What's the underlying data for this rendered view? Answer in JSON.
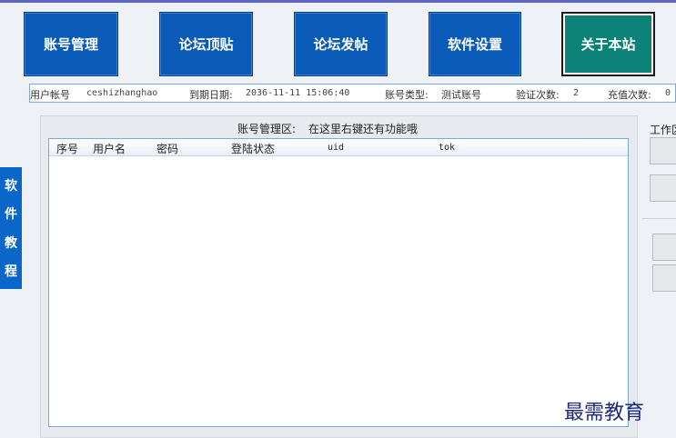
{
  "nav": {
    "account_mgmt": "账号管理",
    "forum_bump": "论坛顶贴",
    "forum_post": "论坛发帖",
    "software_settings": "软件设置",
    "about_site": "关于本站"
  },
  "info": {
    "user_label": "用户帐号",
    "user_value": "ceshizhanghao",
    "expiry_label": "到期日期:",
    "expiry_value": "2036-11-11 15:06:40",
    "type_label": "账号类型:",
    "type_value": "测试账号",
    "verify_label": "验证次数:",
    "verify_value": "2",
    "recharge_label": "充值次数:",
    "recharge_value": "0"
  },
  "side_tab": [
    "软",
    "件",
    "教",
    "程"
  ],
  "panel": {
    "title": "账号管理区:",
    "hint": "在这里右键还有功能哦"
  },
  "columns": [
    "序号",
    "用户名",
    "密码",
    "登陆状态",
    "uid",
    "tok"
  ],
  "right_panel": {
    "label": "工作区"
  },
  "watermark": "最需教育"
}
